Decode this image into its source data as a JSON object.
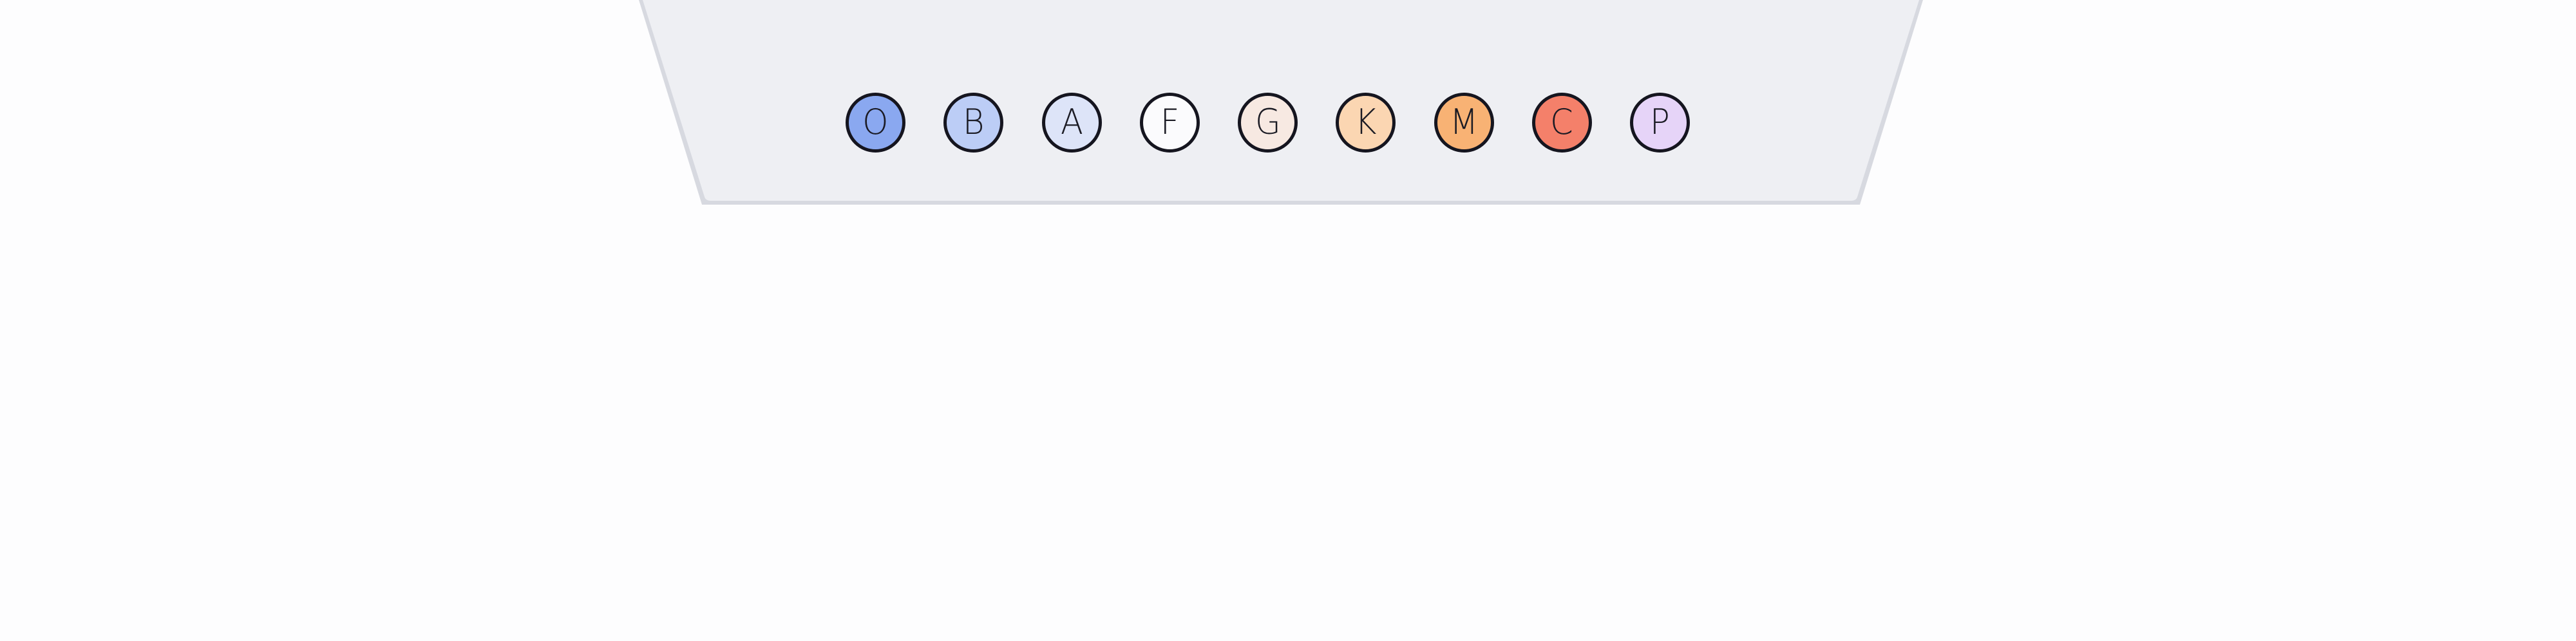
{
  "palette": {
    "swatches": [
      {
        "letter": "O",
        "color": "#8aa8f0"
      },
      {
        "letter": "B",
        "color": "#bccdf6"
      },
      {
        "letter": "A",
        "color": "#dde4f8"
      },
      {
        "letter": "F",
        "color": "#fbfbfd"
      },
      {
        "letter": "G",
        "color": "#f7e9e2"
      },
      {
        "letter": "K",
        "color": "#fbd6b2"
      },
      {
        "letter": "M",
        "color": "#f8b274"
      },
      {
        "letter": "C",
        "color": "#f4806a"
      },
      {
        "letter": "P",
        "color": "#e6d4f8"
      }
    ]
  },
  "colors": {
    "background": "#fdfdfe",
    "tray_fill": "#eeeff3",
    "tray_edge": "#d7d9e0",
    "swatch_border": "#15151f"
  }
}
